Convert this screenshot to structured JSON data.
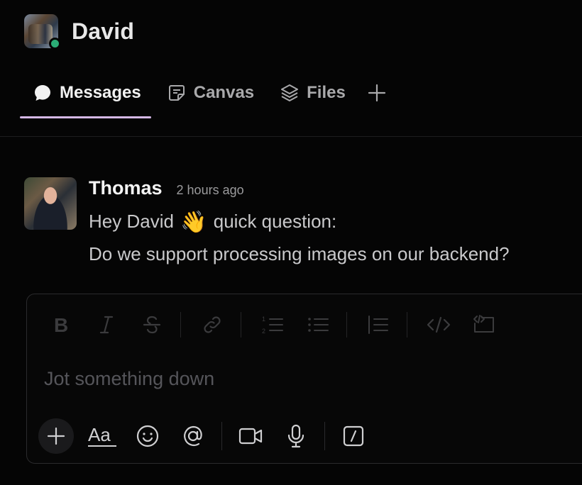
{
  "header": {
    "title": "David"
  },
  "tabs": [
    {
      "label": "Messages",
      "icon": "chat-bubble-icon"
    },
    {
      "label": "Canvas",
      "icon": "canvas-icon"
    },
    {
      "label": "Files",
      "icon": "layers-icon"
    }
  ],
  "message": {
    "sender": "Thomas",
    "time": "2 hours ago",
    "line1_before": "Hey David",
    "emoji": "👋",
    "line1_after": "quick question:",
    "line2": "Do we support processing images on our backend?"
  },
  "composer": {
    "placeholder": "Jot something down",
    "format_tools": [
      "bold",
      "italic",
      "strikethrough",
      "link",
      "ordered-list",
      "bulleted-list",
      "blockquote",
      "code",
      "code-block"
    ],
    "actions": [
      "add",
      "formatting",
      "emoji",
      "mention",
      "video",
      "audio",
      "shortcut"
    ],
    "formatting_label": "Aa"
  },
  "colors": {
    "background": "#050505",
    "tab_indicator": "#d5b8e6",
    "presence": "#2bac76"
  }
}
